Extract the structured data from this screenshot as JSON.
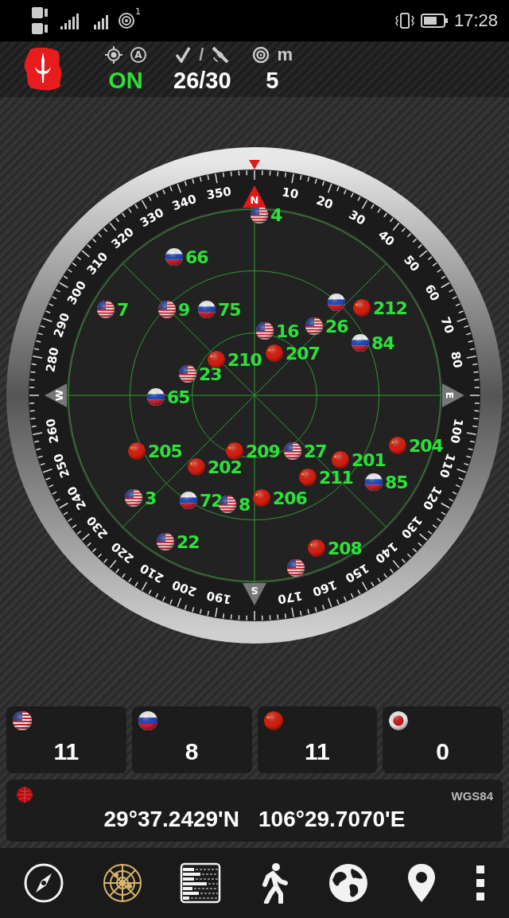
{
  "status_bar": {
    "hotspot_count": "1",
    "time": "17:28"
  },
  "header": {
    "auto_badge": "A",
    "separator": "/",
    "accuracy_unit": "m",
    "gps_state": "ON",
    "satellites_used": "26/30",
    "accuracy": "5"
  },
  "sky_plot": {
    "cardinals": [
      {
        "label": "N",
        "kind": "north"
      },
      {
        "label": "E",
        "kind": "cardinal"
      },
      {
        "label": "S",
        "kind": "cardinal"
      },
      {
        "label": "W",
        "kind": "cardinal"
      }
    ],
    "bearing_labels": [
      "10",
      "20",
      "30",
      "40",
      "50",
      "60",
      "70",
      "80",
      "100",
      "110",
      "120",
      "130",
      "140",
      "150",
      "160",
      "170",
      "190",
      "200",
      "210",
      "220",
      "230",
      "240",
      "250",
      "260",
      "280",
      "290",
      "300",
      "310",
      "320",
      "330",
      "340",
      "350"
    ],
    "satellites": [
      {
        "kind": "gps",
        "label": "4"
      },
      {
        "kind": "glonass",
        "label": "66"
      },
      {
        "kind": "gps",
        "label": "7"
      },
      {
        "kind": "gps",
        "label": "9"
      },
      {
        "kind": "glonass",
        "label": "75"
      },
      {
        "kind": "glonass"
      },
      {
        "kind": "gps",
        "label": "26"
      },
      {
        "kind": "beidou",
        "label": "212"
      },
      {
        "kind": "glonass",
        "label": "84"
      },
      {
        "kind": "gps",
        "label": "16"
      },
      {
        "kind": "beidou",
        "label": "207"
      },
      {
        "kind": "gps",
        "label": "23"
      },
      {
        "kind": "beidou",
        "label": "210"
      },
      {
        "kind": "glonass",
        "label": "65"
      },
      {
        "kind": "beidou",
        "label": "205"
      },
      {
        "kind": "beidou",
        "label": "202"
      },
      {
        "kind": "beidou",
        "label": "209"
      },
      {
        "kind": "gps",
        "label": "27"
      },
      {
        "kind": "beidou",
        "label": "201"
      },
      {
        "kind": "glonass",
        "label": "85"
      },
      {
        "kind": "beidou",
        "label": "211"
      },
      {
        "kind": "beidou",
        "label": "204"
      },
      {
        "kind": "gps",
        "label": "3"
      },
      {
        "kind": "glonass",
        "label": "72"
      },
      {
        "kind": "gps",
        "label": "8"
      },
      {
        "kind": "beidou",
        "label": "206"
      },
      {
        "kind": "gps",
        "label": "22"
      },
      {
        "kind": "beidou",
        "label": "208"
      },
      {
        "kind": "gps"
      }
    ]
  },
  "constellations": [
    {
      "kind": "gps",
      "count": "11"
    },
    {
      "kind": "glonass",
      "count": "8"
    },
    {
      "kind": "beidou",
      "count": "11"
    },
    {
      "kind": "other",
      "count": "0"
    }
  ],
  "location": {
    "datum": "WGS84",
    "latitude": "29°37.2429'N",
    "longitude": "106°29.7070'E"
  },
  "nav": [
    {
      "kind": "compass",
      "selected": false
    },
    {
      "kind": "radar",
      "selected": true
    },
    {
      "kind": "bars",
      "selected": false
    },
    {
      "kind": "walk",
      "selected": false
    },
    {
      "kind": "globe",
      "selected": false
    },
    {
      "kind": "pin",
      "selected": false
    },
    {
      "kind": "menu",
      "selected": false
    }
  ]
}
